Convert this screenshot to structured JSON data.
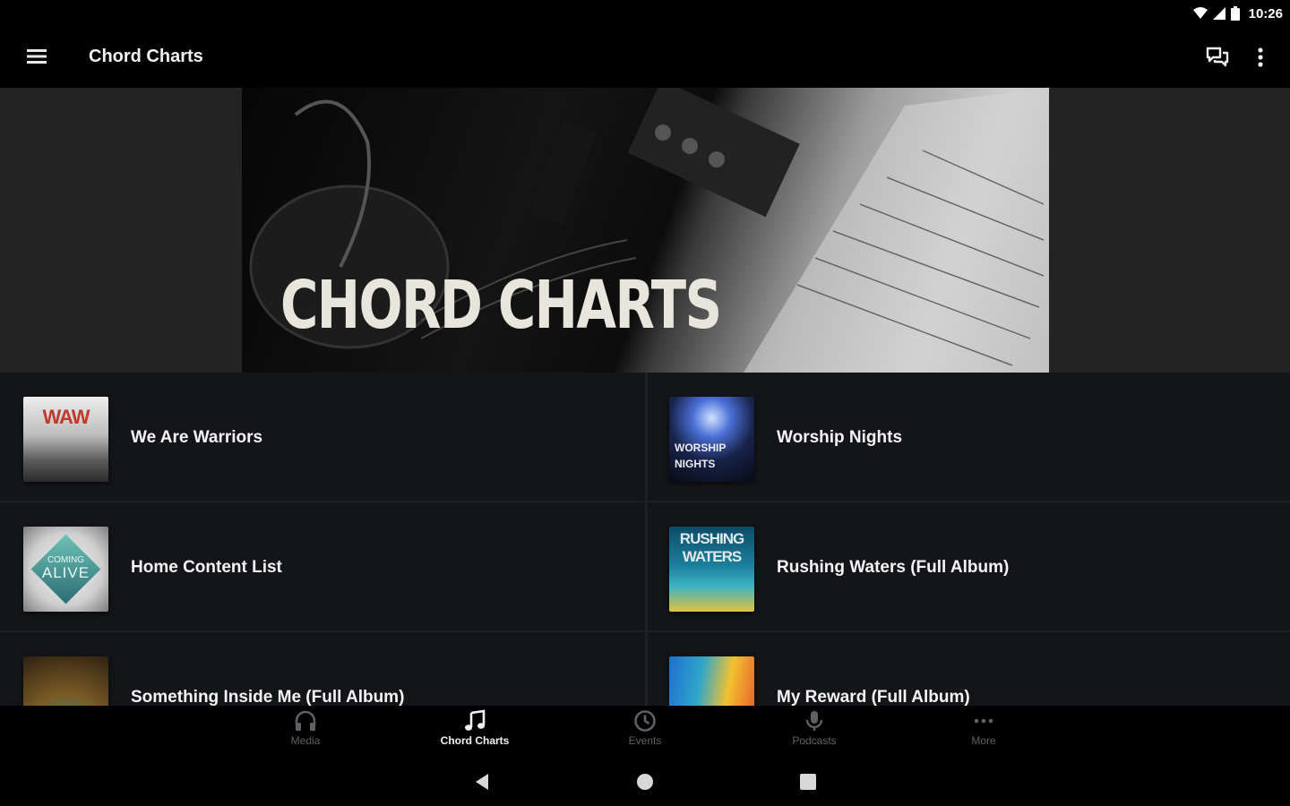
{
  "status_bar": {
    "time": "10:26"
  },
  "app_bar": {
    "title": "Chord Charts"
  },
  "hero": {
    "title": "CHORD CHARTS"
  },
  "items": [
    {
      "label": "We Are Warriors"
    },
    {
      "label": "Worship Nights"
    },
    {
      "label": "Home Content List"
    },
    {
      "label": "Rushing Waters (Full Album)"
    },
    {
      "label": "Something Inside Me (Full Album)"
    },
    {
      "label": "My Reward (Full Album)"
    }
  ],
  "thumbs": {
    "warriors": "WAW",
    "worship_line1": "WORSHIP",
    "worship_line2": "NIGHTS",
    "alive_line1": "COMING",
    "alive_line2": "ALIVE",
    "rushing_line1": "RUSHING",
    "rushing_line2": "WATERS"
  },
  "bottom_nav": [
    {
      "label": "Media",
      "icon": "headphones-icon"
    },
    {
      "label": "Chord Charts",
      "icon": "music-note-icon",
      "active": true
    },
    {
      "label": "Events",
      "icon": "clock-icon"
    },
    {
      "label": "Podcasts",
      "icon": "microphone-icon"
    },
    {
      "label": "More",
      "icon": "more-dots-icon"
    }
  ],
  "colors": {
    "background": "#131518",
    "hero_bg": "#232323",
    "inactive_nav": "#5d6064",
    "active_nav": "#f2f2f2"
  }
}
